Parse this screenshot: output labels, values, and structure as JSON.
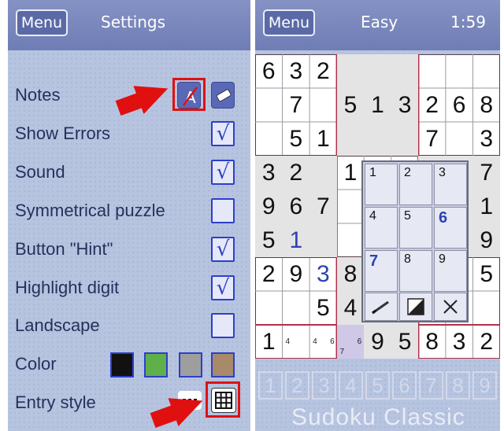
{
  "settings_screen": {
    "menu_label": "Menu",
    "title": "Settings",
    "rows": [
      {
        "label": "Notes"
      },
      {
        "label": "Show Errors",
        "checked": true
      },
      {
        "label": "Sound",
        "checked": true
      },
      {
        "label": "Symmetrical puzzle",
        "checked": false
      },
      {
        "label": "Button \"Hint\"",
        "checked": true
      },
      {
        "label": "Highlight digit",
        "checked": true
      },
      {
        "label": "Landscape",
        "checked": false
      },
      {
        "label": "Color"
      },
      {
        "label": "Entry style"
      }
    ],
    "check_mark": "√",
    "color_options": [
      "#111111",
      "#5fb04a",
      "#9e9e9e",
      "#a88a6a"
    ],
    "notes_tools": [
      "pen-icon",
      "eraser-icon"
    ],
    "entry_styles": [
      "keypad-strip-icon",
      "grid-icon"
    ],
    "annotation_color": "#e01010"
  },
  "game_screen": {
    "menu_label": "Menu",
    "difficulty": "Easy",
    "timer": "1:59",
    "grid": [
      [
        "6",
        "3",
        "2",
        "",
        "",
        "",
        "",
        "",
        ""
      ],
      [
        "",
        "7",
        "",
        "5",
        "1",
        "3",
        "2",
        "6",
        "8"
      ],
      [
        "",
        "5",
        "1",
        "",
        "",
        "",
        "7",
        "",
        "3"
      ],
      [
        "3",
        "2",
        "",
        "1",
        "",
        "",
        "",
        "",
        "7"
      ],
      [
        "9",
        "6",
        "7",
        "",
        "",
        "",
        "",
        "",
        "1"
      ],
      [
        "5",
        "1",
        "",
        "",
        "",
        "",
        "",
        "",
        "9"
      ],
      [
        "2",
        "9",
        "3",
        "8",
        "",
        "",
        "",
        "",
        "5"
      ],
      [
        "",
        "",
        "5",
        "4",
        "",
        "",
        "",
        "",
        ""
      ],
      [
        "1",
        "",
        "",
        "",
        "9",
        "5",
        "8",
        "3",
        "2"
      ]
    ],
    "user_entries": [
      [
        5,
        1
      ],
      [
        6,
        2
      ]
    ],
    "notes": [
      {
        "row": 8,
        "col": 1,
        "digits": [
          "4"
        ]
      },
      {
        "row": 8,
        "col": 2,
        "digits": [
          "4",
          "6"
        ]
      },
      {
        "row": 8,
        "col": 3,
        "digits": [
          "7",
          "6"
        ]
      }
    ],
    "selected_cell": {
      "row": 8,
      "col": 3
    },
    "notes_popup": {
      "digits": [
        "1",
        "2",
        "3",
        "4",
        "5",
        "6",
        "7",
        "8",
        "9"
      ],
      "active_digits": [
        "6",
        "7"
      ],
      "tools": [
        "pencil-icon",
        "contrast-icon",
        "close-icon"
      ]
    },
    "number_bar": [
      "1",
      "2",
      "3",
      "4",
      "5",
      "6",
      "7",
      "8",
      "9"
    ],
    "app_name": "Sudoku Classic"
  }
}
